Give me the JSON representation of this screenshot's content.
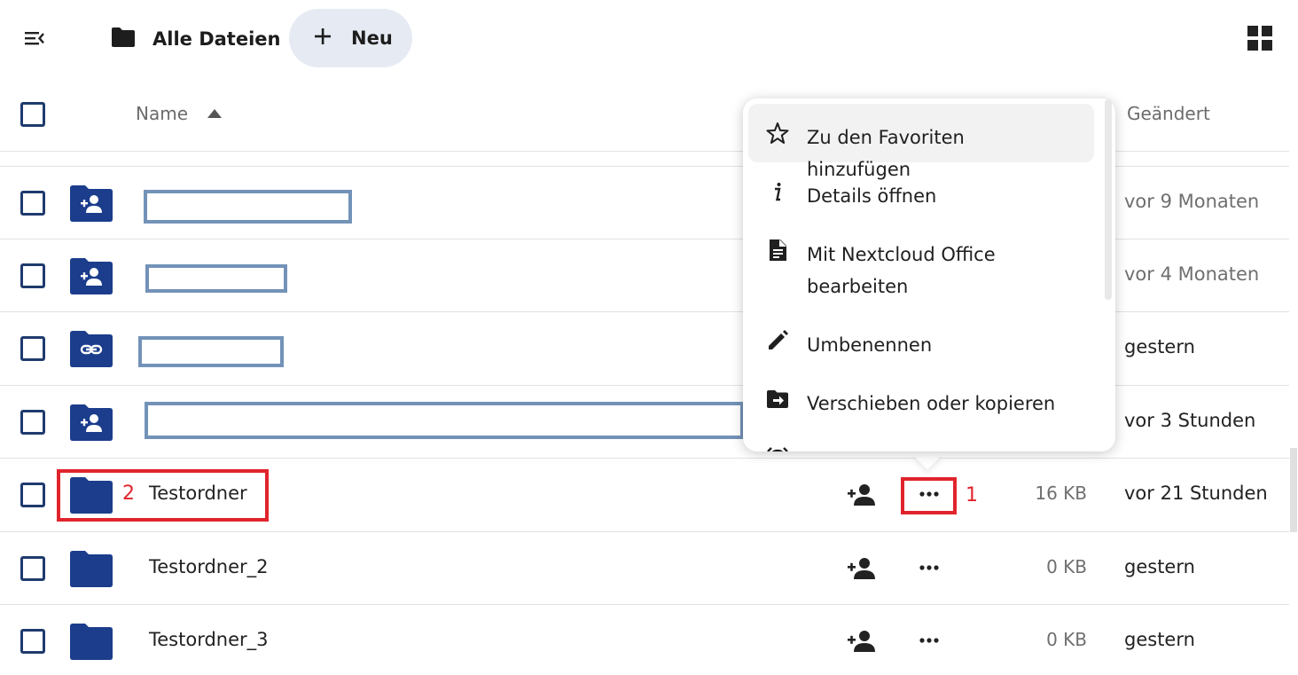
{
  "topbar": {
    "nav_toggle_icon": "menu-collapse-icon",
    "breadcrumb_icon": "folder-icon",
    "breadcrumb_label": "Alle Dateien",
    "new_button_icon": "plus-icon",
    "new_button_label": "Neu",
    "view_toggle_icon": "grid-view-icon"
  },
  "table_header": {
    "name_label": "Name",
    "sort_icon": "sort-ascending-icon",
    "modified_label": "Geändert"
  },
  "rows": [
    {
      "icon": "shared-folder-icon",
      "name": "",
      "size": "",
      "modified": "vor 9 Monaten",
      "redacted": true
    },
    {
      "icon": "shared-folder-icon",
      "name": "",
      "size": "",
      "modified": "vor 4 Monaten",
      "redacted": true
    },
    {
      "icon": "link-folder-icon",
      "name": "",
      "size": "",
      "modified": "gestern",
      "redacted": true
    },
    {
      "icon": "shared-folder-icon",
      "name": "",
      "size": "",
      "modified": "vor 3 Stunden",
      "redacted": true
    },
    {
      "icon": "folder-icon",
      "name": "Testordner",
      "size": "16 KB",
      "modified": "vor 21 Stunden",
      "redacted": false
    },
    {
      "icon": "folder-icon",
      "name": "Testordner_2",
      "size": "0 KB",
      "modified": "gestern",
      "redacted": false
    },
    {
      "icon": "folder-icon",
      "name": "Testordner_3",
      "size": "0 KB",
      "modified": "gestern",
      "redacted": false
    }
  ],
  "context_menu": {
    "items": [
      {
        "icon": "star-icon",
        "label": "Zu den Favoriten hinzufügen"
      },
      {
        "icon": "info-icon",
        "label": "Details öffnen"
      },
      {
        "icon": "document-icon",
        "label": "Mit Nextcloud Office bearbeiten"
      },
      {
        "icon": "pencil-icon",
        "label": "Umbenennen"
      },
      {
        "icon": "move-folder-icon",
        "label": "Verschieben oder kopieren"
      },
      {
        "icon": "alarm-icon",
        "label": ""
      }
    ]
  },
  "annotations": {
    "marker_1": "1",
    "marker_2": "2",
    "color": "#e0242c"
  },
  "colors": {
    "folder": "#1b3d8c",
    "accent_bg": "#e6ebf3",
    "redaction_border": "#7392b8"
  }
}
